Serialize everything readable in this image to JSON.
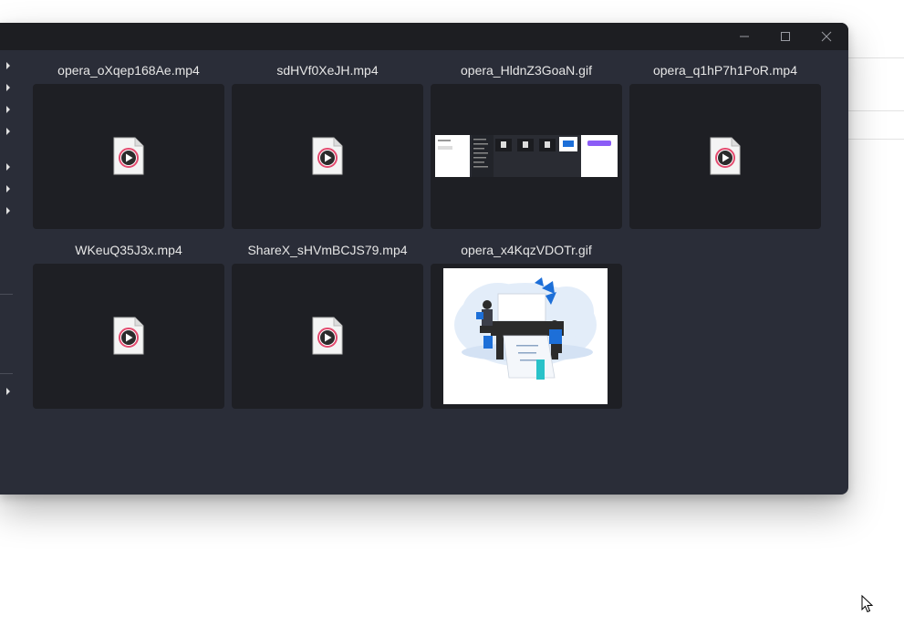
{
  "window_controls": {
    "minimize_icon": "minimize-icon",
    "maximize_icon": "maximize-icon",
    "close_icon": "close-icon"
  },
  "files": [
    {
      "name": "opera_oXqep168Ae.mp4",
      "kind": "video"
    },
    {
      "name": "sdHVf0XeJH.mp4",
      "kind": "video"
    },
    {
      "name": "opera_HldnZ3GoaN.gif",
      "kind": "gif-screenshot"
    },
    {
      "name": "opera_q1hP7h1PoR.mp4",
      "kind": "video"
    },
    {
      "name": "WKeuQ35J3x.mp4",
      "kind": "video"
    },
    {
      "name": "ShareX_sHVmBCJS79.mp4",
      "kind": "video"
    },
    {
      "name": "opera_x4KqzVDOTr.gif",
      "kind": "gif-illustration"
    }
  ],
  "colors": {
    "window_bg": "#2a2d38",
    "titlebar_bg": "#1d1e22",
    "tile_bg": "#1e1f24",
    "text": "#e6e6e6",
    "accent_purple": "#8b5cf6",
    "illustration_blue": "#1d6fd8"
  }
}
